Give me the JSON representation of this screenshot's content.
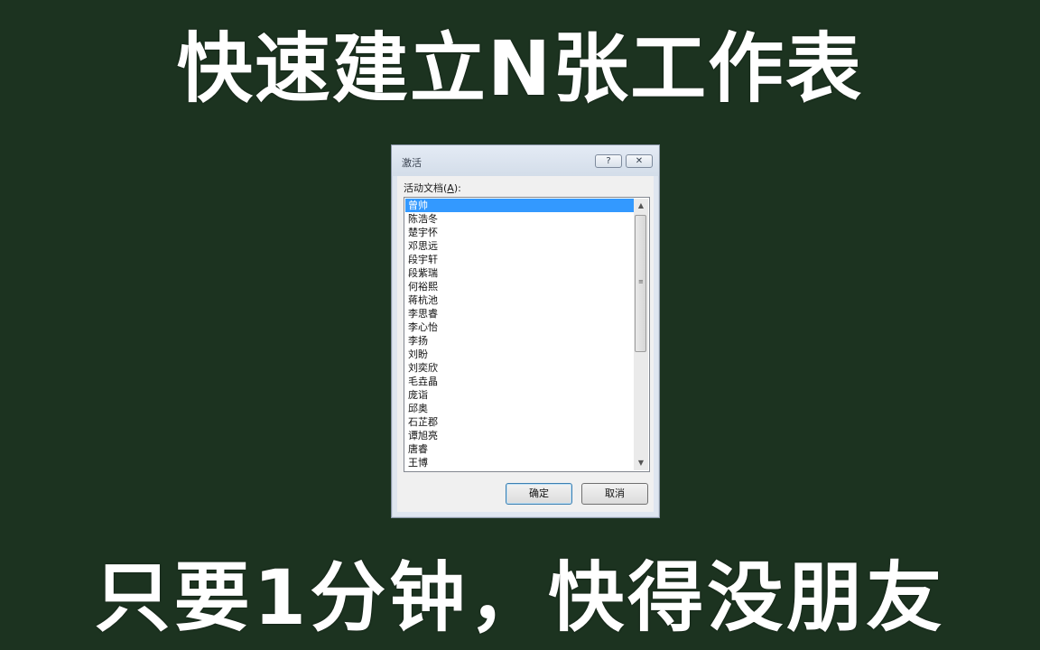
{
  "headline_top": "快速建立N张工作表",
  "headline_bottom": "只要1分钟，快得没朋友",
  "dialog": {
    "title": "激活",
    "help_button": "?",
    "close_button": "✕",
    "list_label_prefix": "活动文档(",
    "list_label_accel": "A",
    "list_label_suffix": "):",
    "items": [
      "曾帅",
      "陈浩冬",
      "楚宇怀",
      "邓思远",
      "段宇轩",
      "段紫瑞",
      "何裕熙",
      "蒋杭池",
      "李思睿",
      "李心怡",
      "李扬",
      "刘盼",
      "刘奕欣",
      "毛垚晶",
      "庞诣",
      "邱奥",
      "石芷郡",
      "谭旭亮",
      "唐睿",
      "王博"
    ],
    "selected_index": 0,
    "ok_label": "确定",
    "cancel_label": "取消"
  },
  "colors": {
    "background": "#1c3320",
    "selection": "#3399ff"
  }
}
